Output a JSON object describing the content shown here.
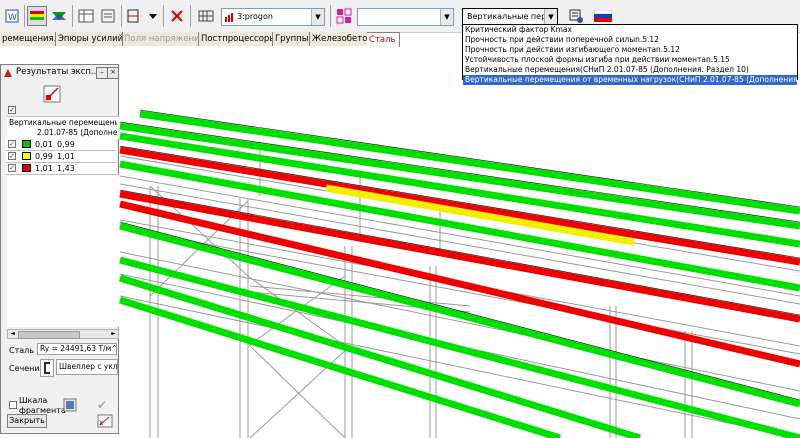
{
  "toolbar": {
    "combo_group": "3:progon",
    "combo_empty": "",
    "combo_result": "Вертикальные перемещ"
  },
  "tabs": [
    {
      "label": "ремещения..."
    },
    {
      "label": "Эпюры усилий"
    },
    {
      "label": "Поля напряжений"
    },
    {
      "label": "Постпроцессоры"
    },
    {
      "label": "Группы"
    },
    {
      "label": "Железобетон"
    },
    {
      "label": "Сталь"
    }
  ],
  "dropdown": {
    "items": [
      "Критический фактор Kmax",
      "Прочность при действии поперечной силыn.5.12",
      "Прочность при действии изгибающего моментаn.5.12",
      "Устойчивость плоской формы изгиба при действии моментаn.5.15",
      "Вертикальные перемещения(СНиП 2.01.07-85 (Дополнения. Раздел 10)",
      "Вертикальные перемещения от временных нагрузок(СНиП 2.01.07-85 (Дополнения. Раздел 10)"
    ]
  },
  "panel": {
    "title": "Результаты эксп...",
    "legend_title": "Вертикальные перемещения (СНиП 2.01.07-85 (Дополне",
    "legend_title_line1": "Вертикальные перемещения с",
    "legend_title_line2": "2.01.07-85 (Дополне",
    "rows": [
      {
        "from": "0,01",
        "to": "0,99",
        "color": "#00c800"
      },
      {
        "from": "0,99",
        "to": "1,01",
        "color": "#ffff00"
      },
      {
        "from": "1,01",
        "to": "1,43",
        "color": "#e00000"
      }
    ],
    "steel_label": "Сталь",
    "steel_value": "Ry = 24491,63 Т/м^2;",
    "section_label": "Сечение",
    "section_value": "Швеллер с укл",
    "scale_label_1": "Шкала",
    "scale_label_2": "фрагмента",
    "close_label": "Закрыть"
  },
  "colors": {
    "green": "#00e000",
    "red": "#ee0000",
    "yellow": "#f0f000",
    "accent": "#316ac5"
  }
}
